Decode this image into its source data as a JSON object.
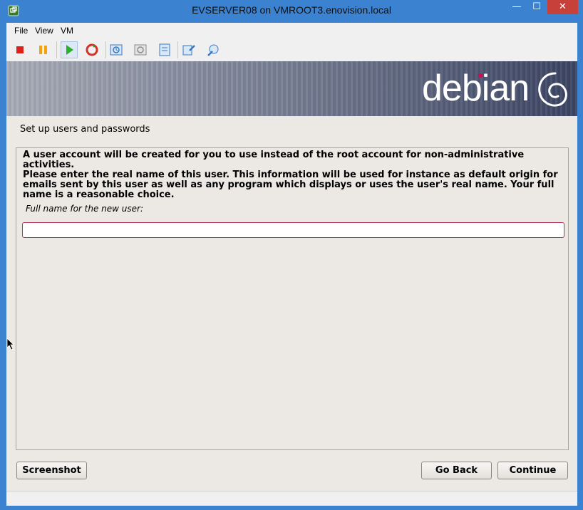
{
  "window": {
    "title": "EVSERVER08 on VMROOT3.enovision.local",
    "minimize": "—",
    "maximize": "☐",
    "close": "✕"
  },
  "menu": [
    "File",
    "View",
    "VM"
  ],
  "toolbar": {
    "buttons": [
      "stop-icon",
      "pause-icon",
      "start-icon",
      "reset-icon",
      "snapshot-icon",
      "revert-icon",
      "checkpoint-icon",
      "settings-icon",
      "tools-icon"
    ]
  },
  "installer": {
    "logo": "debian",
    "page_title": "Set up users and passwords",
    "intro": "A user account will be created for you to use instead of the root account for non-administrative activities.",
    "description": "Please enter the real name of this user. This information will be used for instance as default origin for emails sent by this user as well as any program which displays or uses the user's real name. Your full name is a reasonable choice.",
    "field_label": "Full name for the new user:",
    "field_value": "",
    "screenshot_label": "Screenshot",
    "back_label": "Go Back",
    "continue_label": "Continue"
  },
  "colors": {
    "title_bar": "#3b82d1",
    "close_button": "#c7403a",
    "debian_accent": "#d70751",
    "input_border": "#b0305a"
  }
}
